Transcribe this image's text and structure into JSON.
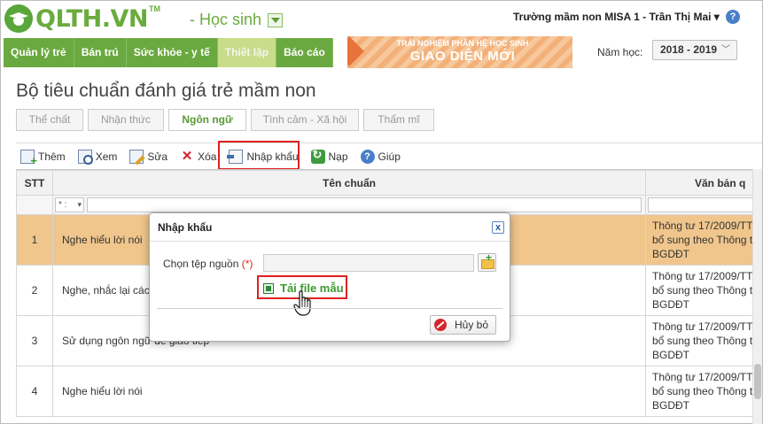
{
  "header": {
    "logo_text": "QLTH.VN",
    "logo_tm": "TM",
    "role": "- Học sinh",
    "school_user": "Trường mầm non MISA 1 - Trần Thị Mai ▾",
    "help_glyph": "?"
  },
  "nav": {
    "tabs": [
      {
        "label": "Quản lý trẻ"
      },
      {
        "label": "Bán trú"
      },
      {
        "label": "Sức khỏe - y tế"
      },
      {
        "label": "Thiết lập"
      },
      {
        "label": "Báo cáo"
      }
    ],
    "active_tab": 3,
    "banner_line1": "TRẢI NGHIỆM PHÂN HỆ HỌC SINH",
    "banner_line2": "GIAO DIỆN MỚI",
    "year_label": "Năm học:",
    "year_value": "2018 - 2019"
  },
  "page": {
    "title": "Bộ tiêu chuẩn đánh giá trẻ mầm non",
    "tabs": [
      {
        "label": "Thể chất"
      },
      {
        "label": "Nhận thức"
      },
      {
        "label": "Ngôn ngữ"
      },
      {
        "label": "Tình cảm - Xã hội"
      },
      {
        "label": "Thẩm mĩ"
      }
    ],
    "active_tab": 2
  },
  "toolbar": {
    "add": "Thêm",
    "view": "Xem",
    "edit": "Sửa",
    "delete": "Xóa",
    "import": "Nhập khẩu",
    "reload": "Nạp",
    "help": "Giúp"
  },
  "grid": {
    "columns": {
      "stt": "STT",
      "name": "Tên chuẩn",
      "doc": "Văn bản q"
    },
    "filter_op": "* :",
    "rows": [
      {
        "stt": "1",
        "name": "Nghe hiểu lời nói",
        "doc": [
          "Thông tư 17/2009/TT",
          "bổ sung theo Thông t",
          "BGDĐT"
        ]
      },
      {
        "stt": "2",
        "name": "Nghe, nhắc lại các â",
        "doc": [
          "Thông tư 17/2009/TT",
          "bổ sung theo Thông t",
          "BGDĐT"
        ]
      },
      {
        "stt": "3",
        "name": "Sử dụng ngôn ngữ để giao tiếp",
        "doc": [
          "Thông tư 17/2009/TT",
          "bổ sung theo Thông t",
          "BGDĐT"
        ]
      },
      {
        "stt": "4",
        "name": "Nghe hiểu lời nói",
        "doc": [
          "Thông tư 17/2009/TT",
          "bổ sung theo Thông t",
          "BGDĐT"
        ]
      }
    ],
    "selected_row": 0
  },
  "dialog": {
    "title": "Nhập khẩu",
    "close_glyph": "x",
    "source_label": "Chọn tệp nguồn",
    "required_mark": "(*)",
    "download_template": "Tải file mẫu",
    "cancel": "Hủy bỏ"
  }
}
